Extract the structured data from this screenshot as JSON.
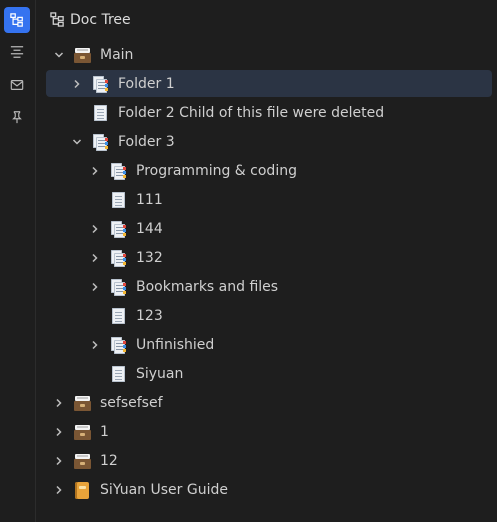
{
  "dock": {
    "items": [
      {
        "icon": "doc-tree-icon",
        "active": true
      },
      {
        "icon": "outline-icon",
        "active": false
      },
      {
        "icon": "inbox-icon",
        "active": false
      },
      {
        "icon": "bookmark-pin-icon",
        "active": false
      }
    ]
  },
  "panel": {
    "title": "Doc Tree",
    "header_icon": "doc-tree-icon"
  },
  "tree": {
    "rows": [
      {
        "label": "Main",
        "depth": 0,
        "arrow": "expanded",
        "icon": "card-box-icon",
        "selected": false
      },
      {
        "label": "Folder 1",
        "depth": 1,
        "arrow": "collapsed",
        "icon": "pages-icon",
        "selected": true
      },
      {
        "label": "Folder 2 Child of this file were deleted",
        "depth": 1,
        "arrow": "none",
        "icon": "page-icon",
        "selected": false
      },
      {
        "label": "Folder 3",
        "depth": 1,
        "arrow": "expanded",
        "icon": "pages-icon",
        "selected": false
      },
      {
        "label": "Programming & coding",
        "depth": 2,
        "arrow": "collapsed",
        "icon": "pages-icon",
        "selected": false
      },
      {
        "label": "111",
        "depth": 2,
        "arrow": "none",
        "icon": "page-icon",
        "selected": false
      },
      {
        "label": "144",
        "depth": 2,
        "arrow": "collapsed",
        "icon": "pages-icon",
        "selected": false
      },
      {
        "label": "132",
        "depth": 2,
        "arrow": "collapsed",
        "icon": "pages-icon",
        "selected": false
      },
      {
        "label": "Bookmarks and files",
        "depth": 2,
        "arrow": "collapsed",
        "icon": "pages-icon",
        "selected": false
      },
      {
        "label": "123",
        "depth": 2,
        "arrow": "none",
        "icon": "page-icon",
        "selected": false
      },
      {
        "label": "Unfinishied",
        "depth": 2,
        "arrow": "collapsed",
        "icon": "pages-icon",
        "selected": false
      },
      {
        "label": "Siyuan",
        "depth": 2,
        "arrow": "none",
        "icon": "page-icon",
        "selected": false
      },
      {
        "label": "sefsefsef",
        "depth": 0,
        "arrow": "collapsed",
        "icon": "card-box-icon",
        "selected": false
      },
      {
        "label": "1",
        "depth": 0,
        "arrow": "collapsed",
        "icon": "card-box-icon",
        "selected": false
      },
      {
        "label": "12",
        "depth": 0,
        "arrow": "collapsed",
        "icon": "card-box-icon",
        "selected": false
      },
      {
        "label": "SiYuan User Guide",
        "depth": 0,
        "arrow": "collapsed",
        "icon": "notebook-icon",
        "selected": false
      }
    ]
  },
  "colors": {
    "background": "#1e1e1e",
    "accent": "#3573f0",
    "selected_row": "#2b3444",
    "text": "#cfcfcf"
  }
}
